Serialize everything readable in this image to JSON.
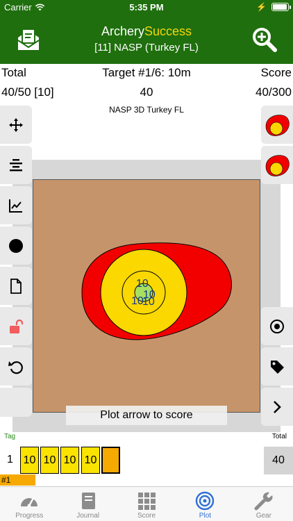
{
  "status": {
    "carrier": "Carrier",
    "time": "5:35 PM"
  },
  "nav": {
    "title_a": "Archery",
    "title_b": "Success",
    "subtitle": "[11] NASP (Turkey FL)",
    "left_icon": "scorecard-icon",
    "right_icon": "zoom-in-icon"
  },
  "header": {
    "total_label": "Total",
    "target_label": "Target #1/6: 10m",
    "score_label": "Score",
    "total_value": "40/50 [10]",
    "target_value": "40",
    "score_value": "40/300"
  },
  "target_name": "NASP 3D Turkey FL",
  "plot": {
    "arrow_labels": [
      "10",
      "10",
      "10",
      "10"
    ],
    "hint": "Plot arrow to score",
    "colors": {
      "outer": "#f20000",
      "yellow": "#fad800",
      "center": "#a8e060",
      "face": "#c6946a"
    }
  },
  "left_tools": [
    "move-icon",
    "align-icon",
    "chart-icon",
    "dot-icon",
    "document-icon",
    "unlock-icon",
    "undo-icon"
  ],
  "right_tools": [
    "target-face-icon",
    "target-face-icon",
    "target-center-icon",
    "tag-icon",
    "chevron-right-icon"
  ],
  "end": {
    "tag_label": "Tag",
    "total_label": "Total",
    "end_number": "1",
    "arrows": [
      "10",
      "10",
      "10",
      "10"
    ],
    "total": "40",
    "tag": "#1"
  },
  "tabs": [
    {
      "label": "Progress",
      "icon": "gauge-icon"
    },
    {
      "label": "Journal",
      "icon": "journal-icon"
    },
    {
      "label": "Score",
      "icon": "grid-icon"
    },
    {
      "label": "Plot",
      "icon": "target-icon",
      "active": true
    },
    {
      "label": "Gear",
      "icon": "wrench-icon"
    }
  ]
}
